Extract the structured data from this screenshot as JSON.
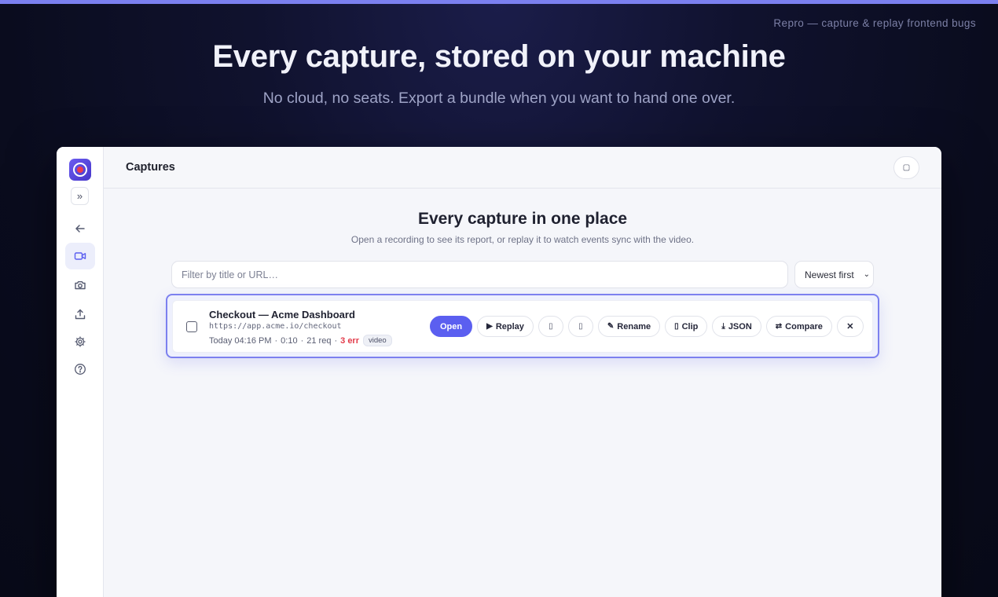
{
  "hero": {
    "brand_tag": "Repro — capture & replay frontend bugs",
    "title": "Every capture, stored on your machine",
    "subtitle": "No cloud, no seats. Export a bundle when you want to hand one over."
  },
  "sidebar": {
    "items": [
      {
        "name": "back",
        "icon": "arrow-left-icon"
      },
      {
        "name": "video",
        "icon": "video-icon",
        "active": true
      },
      {
        "name": "camera",
        "icon": "camera-icon"
      },
      {
        "name": "upload",
        "icon": "upload-icon"
      },
      {
        "name": "settings",
        "icon": "gear-icon"
      },
      {
        "name": "help",
        "icon": "help-circle-icon"
      }
    ],
    "expand_glyph": "»"
  },
  "header": {
    "title": "Captures",
    "button_glyph": "▢"
  },
  "main": {
    "title": "Every capture in one place",
    "subtitle": "Open a recording to see its report, or replay it to watch events sync with the video.",
    "filter_placeholder": "Filter by title or URL…",
    "sort_value": "Newest first"
  },
  "capture": {
    "title": "Checkout — Acme Dashboard",
    "url": "https://app.acme.io/checkout",
    "date": "Today 04:16 PM",
    "duration": "0:10",
    "requests": "21 req",
    "errors": "3 err",
    "badge": "video",
    "actions": {
      "open": "Open",
      "replay": "Replay",
      "replay_icon": "▶",
      "icon_a": "▯",
      "icon_b": "▯",
      "rename": "Rename",
      "rename_icon": "✎",
      "clip": "Clip",
      "clip_icon": "▯",
      "json": "JSON",
      "json_icon": "⤓",
      "compare": "Compare",
      "compare_icon": "⇄",
      "delete": "✕"
    }
  },
  "colors": {
    "accent": "#5b5ff0",
    "error": "#e23b4a",
    "logo_dot": "#ef3b4c"
  }
}
